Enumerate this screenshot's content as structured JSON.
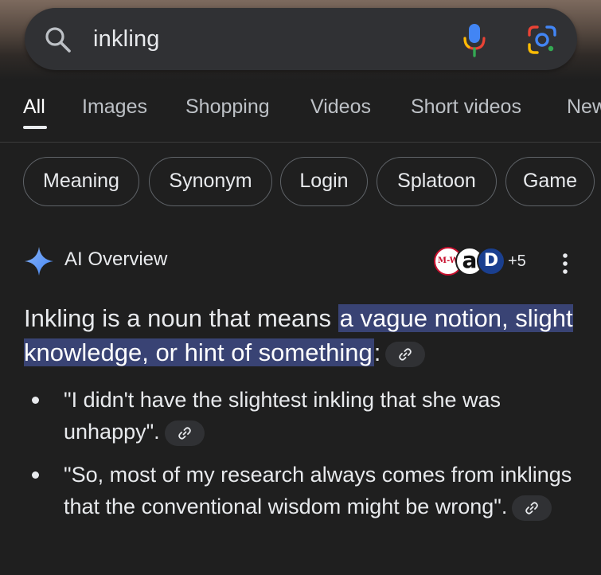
{
  "search": {
    "query": "inkling",
    "icons": [
      "search-icon",
      "microphone-icon",
      "google-lens-icon"
    ]
  },
  "tabs": [
    {
      "label": "All",
      "active": true
    },
    {
      "label": "Images"
    },
    {
      "label": "Shopping"
    },
    {
      "label": "Videos"
    },
    {
      "label": "Short videos"
    },
    {
      "label": "News"
    }
  ],
  "chips": [
    "Meaning",
    "Synonym",
    "Login",
    "Splatoon",
    "Game"
  ],
  "ai_overview": {
    "title": "AI Overview",
    "sources": {
      "mw_label": "M-W",
      "amazon_label": "a",
      "dict_label": "D",
      "more": "+5"
    },
    "lead_before": "Inkling is a noun that means ",
    "lead_highlight": "a vague notion, slight knowledge, or hint of something",
    "lead_after": ":",
    "bullets": [
      "\"I didn't have the slightest inkling that she was unhappy\".",
      "\"So, most of my research always comes from inklings that the conventional wisdom might be wrong\"."
    ]
  },
  "colors": {
    "background": "#1f1f1f",
    "highlight": "#394374",
    "spark_blue": "#4285f4"
  }
}
